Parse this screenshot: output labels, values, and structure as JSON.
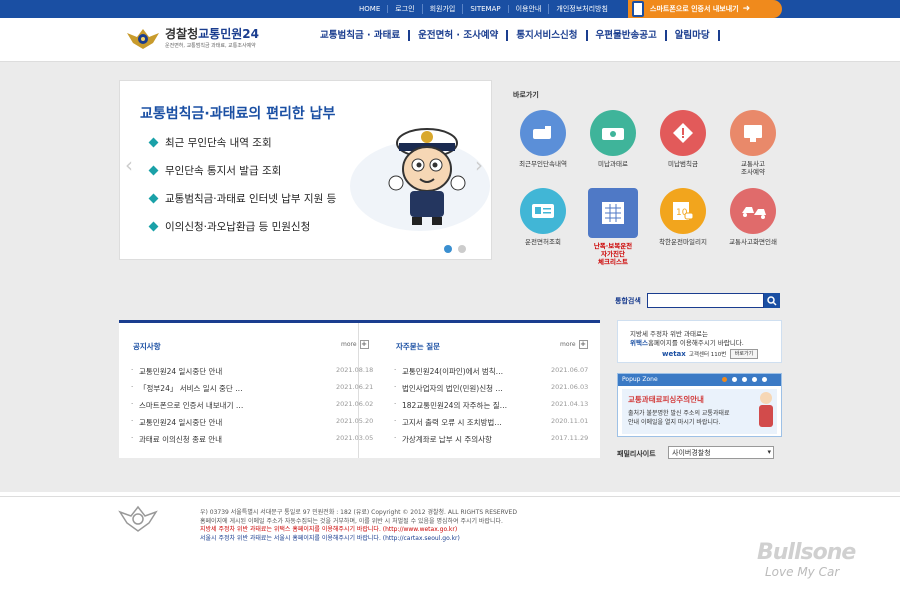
{
  "topbar": {
    "links": [
      "HOME",
      "로그인",
      "회원가입",
      "SITEMAP",
      "이용안내",
      "개인정보처리방침"
    ],
    "smartphone_button": "스마트폰으로 인증서 내보내기"
  },
  "header": {
    "logo_main": "경찰청",
    "logo_accent": "교통민원24",
    "logo_sub": "운전면허, 교통범칙금 과태료, 교통조사예약",
    "nav": [
      "교통범칙금 · 과태료",
      "운전면허 · 조사예약",
      "통지서비스신청",
      "우편물반송공고",
      "알림마당"
    ]
  },
  "banner": {
    "title": "교통범칙금·과태료의 편리한 납부",
    "items": [
      "최근 무인단속 내역 조회",
      "무인단속 통지서 발급 조회",
      "교통범칙금·과태료 인터넷 납부 지원 등",
      "이의신청·과오납환급 등 민원신청"
    ]
  },
  "quick": {
    "title": "바로가기",
    "items": [
      {
        "label": "최근무인단속내역",
        "color": "#5b8fd8",
        "icon": "camera-icon"
      },
      {
        "label": "미납과태료",
        "color": "#3fb49a",
        "icon": "money-icon"
      },
      {
        "label": "미납범칙금",
        "color": "#e25a5a",
        "icon": "warning-icon"
      },
      {
        "label": "교통사고\n조사예약",
        "color": "#e9896a",
        "icon": "monitor-icon"
      },
      {
        "label": "운전면허조회",
        "color": "#41b6d6",
        "icon": "license-icon"
      },
      {
        "label": "난폭·보복운전\n자가진단\n체크리스트",
        "color": "#4f79c6",
        "icon": "checklist-icon"
      },
      {
        "label": "착한운전마일리지",
        "color": "#f2a51d",
        "icon": "mileage-icon"
      },
      {
        "label": "교통사고화면인쇄",
        "color": "#e06b6b",
        "icon": "car-crash-icon"
      }
    ]
  },
  "search": {
    "label": "통합검색",
    "placeholder": ""
  },
  "notice": {
    "title": "공지사항",
    "more": "more",
    "items": [
      {
        "text": "교통민원24 일시중단 안내",
        "date": "2021.08.18"
      },
      {
        "text": "「정부24」 서비스 일시 중단 …",
        "date": "2021.06.21"
      },
      {
        "text": "스마트폰으로 인증서 내보내기 …",
        "date": "2021.06.02"
      },
      {
        "text": "교통민원24 일시중단 안내",
        "date": "2021.05.20"
      },
      {
        "text": "과태료 이의신청 종료 안내",
        "date": "2021.03.05"
      }
    ]
  },
  "faq": {
    "title": "자주묻는 질문",
    "more": "more",
    "items": [
      {
        "text": "교통민원24(이파인)에서 범칙…",
        "date": "2021.06.07"
      },
      {
        "text": "법인사업자의 법인(민원)신청 …",
        "date": "2021.06.03"
      },
      {
        "text": "182교통민원24의 자주하는 질…",
        "date": "2021.04.13"
      },
      {
        "text": "고지서 출력 오류 시 조치방법…",
        "date": "2020.11.01"
      },
      {
        "text": "가상계좌로 납부 시 주의사항",
        "date": "2017.11.29"
      }
    ]
  },
  "wetax": {
    "line1": "지방세 주정차 위반 과태료는",
    "line2_bold": "위택스",
    "line2_rest": "홈페이지를 이용해주시기 바랍니다.",
    "logo": "wetax",
    "center": "고객센터 110번",
    "go": "바로가기"
  },
  "popup": {
    "header": "Popup Zone",
    "title": "교통과태료피싱주의안내",
    "desc1": "출처가 불분명한 발신 주소의 교통과태료",
    "desc2": "안내 이메일을 열지 마시기 바랍니다."
  },
  "family": {
    "label": "패밀리사이트",
    "selected": "사이버경찰청"
  },
  "footer": {
    "address": "우) 03739 서울특별시 서대문구 통일로 97  민원전화 : 182 (유료)          Copyright © 2012 경찰청. ALL RIGHTS RESERVED",
    "notice": "홈페이지에 게시된 이메일 주소가 자동수집되는 것을 거부하며, 이를 위반 시 처벌될 수 있음을 명심하여 주시기 바랍니다.",
    "local": "지방세 주정차 위반 과태료는 위택스 홈페이지를 이용해주시기 바랍니다. (http://www.wetax.go.kr)",
    "seoul": "서울시 주정차 위반 과태료는 서울시 홈페이지를 이용해주시기 바랍니다. (http://cartax.seoul.go.kr)"
  },
  "watermark": {
    "brand": "Bullsone",
    "tagline": "Love My Car"
  }
}
